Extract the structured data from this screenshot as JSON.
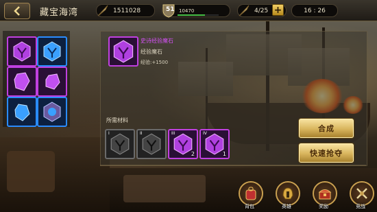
{
  "header": {
    "title": "藏宝海湾",
    "gold": "1511028",
    "level": "51",
    "exp": "10470",
    "stamina": "4/25",
    "clock": "16 : 26"
  },
  "item": {
    "name": "史诗经验魔石",
    "subtitle": "经验魔石",
    "exp": "经验:+1500"
  },
  "materials": {
    "label": "所需材料",
    "slots": [
      {
        "tier": "I",
        "count": ""
      },
      {
        "tier": "II",
        "count": ""
      },
      {
        "tier": "III",
        "count": "2"
      },
      {
        "tier": "IV",
        "count": "1"
      }
    ]
  },
  "buttons": {
    "combine": "合成",
    "quick_loot": "快速抢夺"
  },
  "nav": {
    "bag": "背包",
    "hero": "英雄",
    "reward": "奖励",
    "war": "竞战"
  },
  "colors": {
    "epic": "#d050f0",
    "blue": "#3aa0ff",
    "gold_button": "#d8b45c"
  }
}
